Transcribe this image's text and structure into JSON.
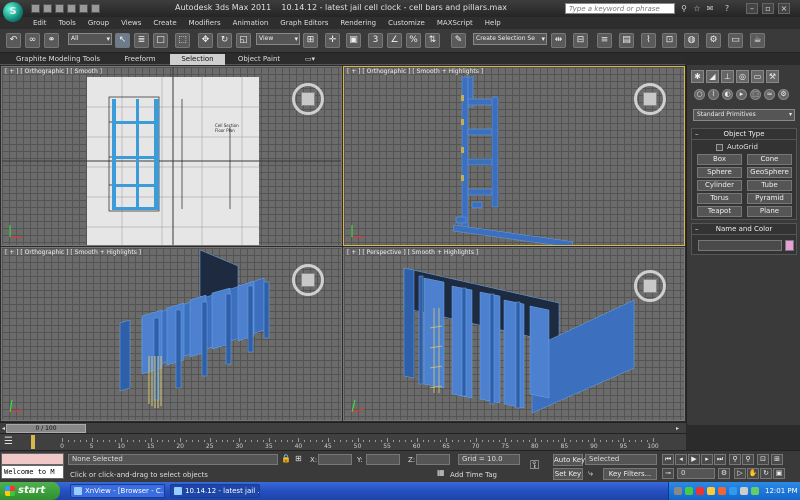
{
  "title_bar": {
    "app_name": "Autodesk 3ds Max  2011",
    "file_title": "10.14.12 - latest jail cell clock - cell bars and pillars.max",
    "search_placeholder": "Type a keyword or phrase"
  },
  "menu": [
    "Edit",
    "Tools",
    "Group",
    "Views",
    "Create",
    "Modifiers",
    "Animation",
    "Graph Editors",
    "Rendering",
    "Customize",
    "MAXScript",
    "Help"
  ],
  "toolbar": {
    "selection_filter": "All",
    "reference_coord": "View",
    "named_selection": "Create Selection Se"
  },
  "ribbon_tabs": [
    "Graphite Modeling Tools",
    "Freeform",
    "Selection",
    "Object Paint"
  ],
  "viewports": {
    "top_left": {
      "label": "[ + ] [ Orthographic ] [ Smooth ]",
      "drawing_text": [
        "Cell Section",
        "Floor Plan"
      ]
    },
    "top_right": {
      "label": "[ + ] [ Orthographic ] [ Smooth + Highlights ]"
    },
    "bottom_left": {
      "label": "[ + ] [ Orthographic ] [ Smooth + Highlights ]"
    },
    "bottom_right": {
      "label": "[ + ] [ Perspective ] [ Smooth + Highlights ]"
    }
  },
  "command_panel": {
    "category_dropdown": "Standard Primitives",
    "object_type_title": "Object Type",
    "autogrid_label": "AutoGrid",
    "primitives": [
      "Box",
      "Cone",
      "Sphere",
      "GeoSphere",
      "Cylinder",
      "Tube",
      "Torus",
      "Pyramid",
      "Teapot",
      "Plane"
    ],
    "name_color_title": "Name and Color",
    "name_value": "",
    "swatch_color": "#e8a0d8"
  },
  "timeline": {
    "slider_label": "0 / 100",
    "ticks": [
      0,
      5,
      10,
      15,
      20,
      25,
      30,
      35,
      40,
      45,
      50,
      55,
      60,
      65,
      70,
      75,
      80,
      85,
      90,
      95,
      100
    ]
  },
  "status": {
    "maxscript_text": "Welcome to M",
    "selection_status": "None Selected",
    "prompt": "Click or click-and-drag to select objects",
    "x_label": "X:",
    "y_label": "Y:",
    "z_label": "Z:",
    "grid": "Grid = 10.0",
    "add_time_tag": "Add Time Tag",
    "auto_key": "Auto Key",
    "set_key": "Set Key",
    "key_mode": "Selected",
    "key_filters": "Key Filters...",
    "current_frame": "0"
  },
  "taskbar": {
    "start_label": "start",
    "tasks": [
      "XnView - [Browser - C...",
      "10.14.12 - latest jail ..."
    ],
    "clock": "12:01 PM"
  },
  "colors": {
    "wall_blue": "#3d6fbf",
    "active_border": "#d8b84a"
  }
}
